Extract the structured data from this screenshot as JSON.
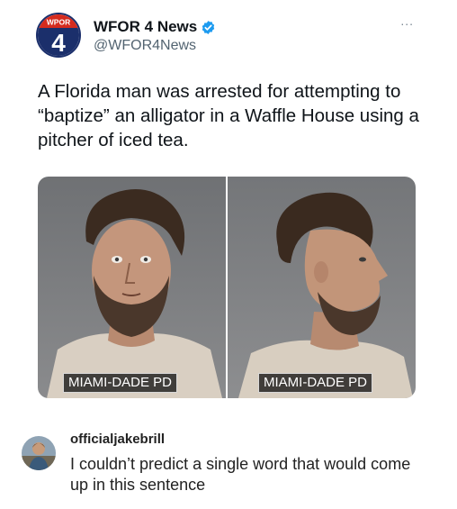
{
  "tweet": {
    "logo_text_small": "WPOR",
    "logo_text_number": "4",
    "display_name": "WFOR 4 News",
    "handle": "@WFOR4News",
    "more_icon": "...",
    "text": "A Florida man was arrested for attempting to “baptize” an alligator in a Waffle House using a pitcher of iced tea.",
    "verified_color": "#1d9bf0",
    "logo_color": "#1b2f6b",
    "logo_accent": "#d52b1e"
  },
  "media": {
    "left_caption": "MIAMI-DADE PD",
    "right_caption": "MIAMI-DADE PD"
  },
  "comment": {
    "username": "officialjakebrill",
    "text": "I couldn’t predict a single word that would come up in this sentence"
  }
}
